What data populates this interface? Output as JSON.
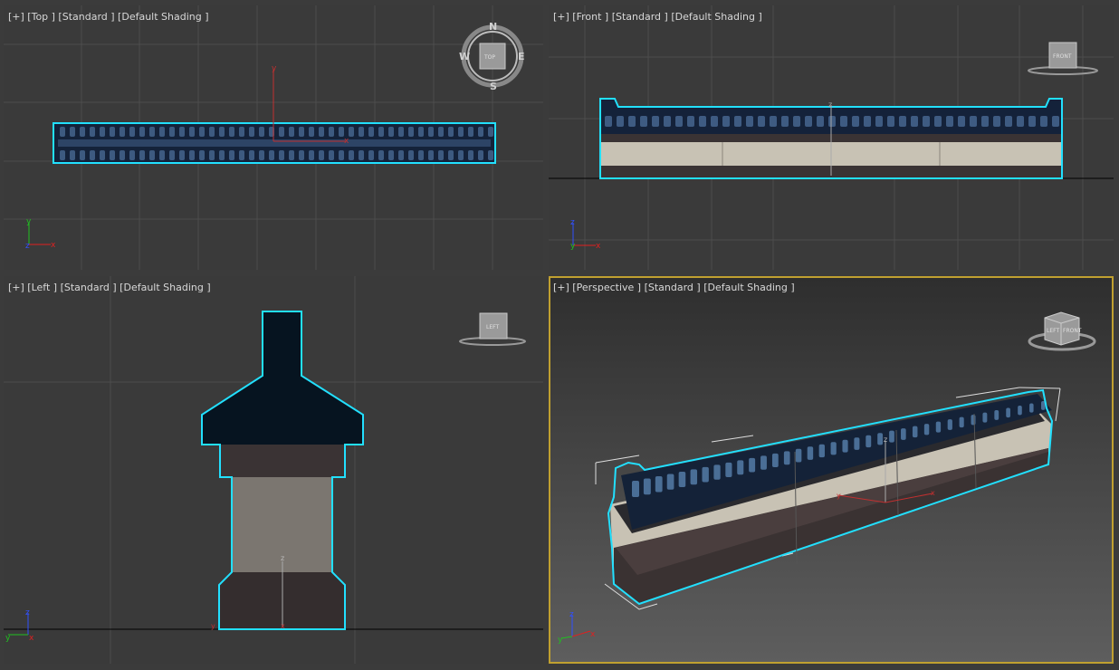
{
  "viewports": {
    "top": {
      "label": "[+] [Top ] [Standard ] [Default Shading ]",
      "cube_text": "TOP"
    },
    "front": {
      "label": "[+] [Front ] [Standard ] [Default Shading ]",
      "cube_text": "FRONT"
    },
    "left": {
      "label": "[+] [Left ] [Standard ] [Default Shading ]",
      "cube_text": "LEFT"
    },
    "perspective": {
      "label": "[+] [Perspective ] [Standard ] [Default Shading ]",
      "cube_text_left": "LEFT",
      "cube_text_front": "FRONT"
    }
  },
  "compass": {
    "n": "N",
    "s": "S",
    "e": "E",
    "w": "W"
  },
  "axes": {
    "x": "x",
    "y": "y",
    "z": "z"
  },
  "colors": {
    "selection": "#22e0ff",
    "axis_x": "#e02020",
    "axis_y": "#20c020",
    "axis_z": "#3050ff",
    "active_border": "#c0a030",
    "tile_dark": "#0e1a2c",
    "plaster": "#c8c2b4",
    "base": "#3a3030"
  }
}
